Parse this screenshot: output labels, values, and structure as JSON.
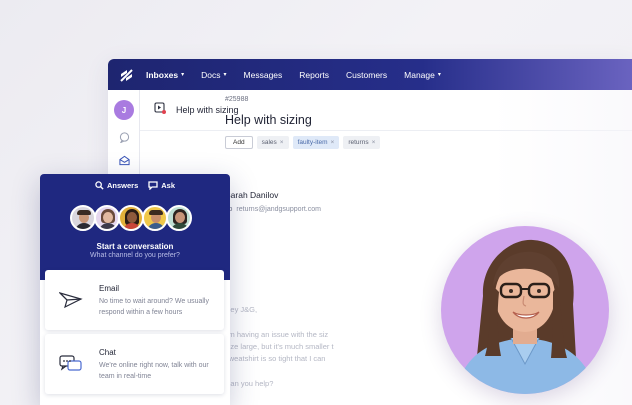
{
  "nav": {
    "items": [
      {
        "label": "Inboxes",
        "caret": true,
        "active": true
      },
      {
        "label": "Docs",
        "caret": true,
        "active": false
      },
      {
        "label": "Messages",
        "caret": false,
        "active": false
      },
      {
        "label": "Reports",
        "caret": false,
        "active": false
      },
      {
        "label": "Customers",
        "caret": false,
        "active": false
      },
      {
        "label": "Manage",
        "caret": true,
        "active": false
      }
    ]
  },
  "sidebar": {
    "avatar_initial": "J"
  },
  "conversation": {
    "header_title": "Help with sizing",
    "ticket_number": "#25988",
    "title": "Help with sizing",
    "add_tag_label": "Add",
    "tags": [
      "sales",
      "faulty-item",
      "returns"
    ],
    "sender_name": "Sarah Danilov",
    "to_label": "To",
    "to_address": "returns@jandgsupport.com",
    "messages": [
      "Hey J&G,",
      "I'm having an issue with the siz",
      "size large, but it's much smaller t",
      "sweatshirt is so tight that I can",
      "Can you help?"
    ]
  },
  "widget": {
    "tab_answers": "Answers",
    "tab_ask": "Ask",
    "start_title": "Start a conversation",
    "start_subtitle": "What channel do you prefer?",
    "email_title": "Email",
    "email_desc": "No time to wait around? We usually respond within a few hours",
    "chat_title": "Chat",
    "chat_desc": "We're online right now, talk with our team in real-time"
  },
  "colors": {
    "nav_bg": "#1e2570",
    "widget_bg": "#1f2880",
    "accent_purple": "#a97be0",
    "portrait_bg": "#cfa4ec"
  }
}
